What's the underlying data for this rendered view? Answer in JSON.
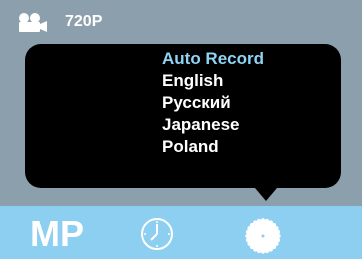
{
  "header": {
    "camera_icon": "video-camera-icon",
    "resolution": "720P"
  },
  "menu": {
    "items": [
      {
        "label": "Auto Record",
        "selected": true
      },
      {
        "label": "English",
        "selected": false
      },
      {
        "label": "Русский",
        "selected": false
      },
      {
        "label": "Japanese",
        "selected": false
      },
      {
        "label": "Poland",
        "selected": false
      }
    ]
  },
  "bottom_bar": {
    "mode_label": "MP",
    "clock_icon": "clock-icon",
    "settings_icon": "gear-icon"
  },
  "colors": {
    "background": "#8c9fac",
    "bottom_bar": "#8ccff0",
    "menu_bg": "#000000",
    "selected_text": "#8fd3f5",
    "text": "#ffffff"
  }
}
